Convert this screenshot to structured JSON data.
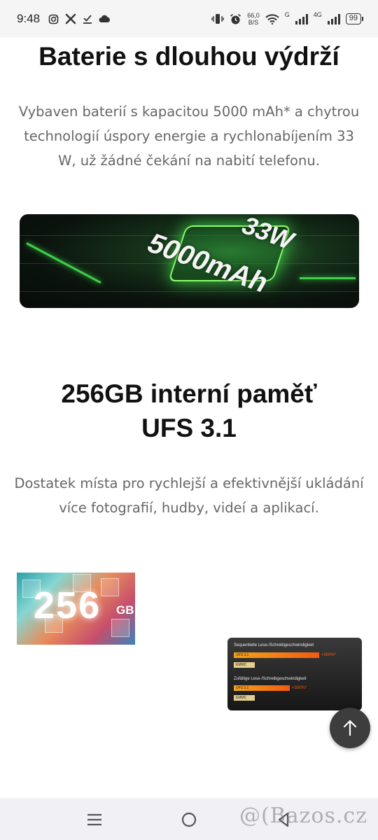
{
  "status_bar": {
    "time": "9:48",
    "net_speed_value": "66,0",
    "net_speed_unit": "B/S",
    "network_1": "G",
    "network_2": "4G",
    "battery_level": "99",
    "left_icons": [
      "instagram-icon",
      "tools-icon",
      "download-check-icon",
      "cloud-icon"
    ],
    "right_icons": [
      "vibrate-icon",
      "alarm-icon",
      "wifi-icon",
      "signal-icon"
    ]
  },
  "battery_section": {
    "heading": "Baterie s dlouhou výdrží",
    "description": "Vybaven baterií s kapacitou 5000 mAh* a chytrou technologií úspory energie a rychlonabíjením 33 W, už žádné čekání na nabití telefonu.",
    "banner_text_power": "33W",
    "banner_text_capacity": "5000mAh",
    "banner_accent": "#3fd04a"
  },
  "storage_section": {
    "heading_line1": "256GB interní paměť",
    "heading_line2": "UFS 3.1",
    "description": "Dostatek místa pro rychlejší a efektivnější ukládání více fotografií, hudby, videí a aplikací.",
    "image_text": "256",
    "image_unit": "GB"
  },
  "speed_card": {
    "sequential_title": "Sequentielle Lese-/Schreibgeschwindigkeit",
    "sequential_ufs_label": "UFS 3.1",
    "sequential_ufs_pct": "+500%*",
    "sequential_emmc_label": "EMMC",
    "random_title": "Zufällige Lese-/Schreibgeschwindigkeit",
    "random_ufs_label": "UFS 3.1",
    "random_ufs_pct": "+300%*",
    "random_emmc_label": "EMMC",
    "accent": "#f25a12"
  },
  "scroll_top_button": {
    "icon": "arrow-up-icon"
  },
  "navigation_bar": {
    "icons": [
      "menu-icon",
      "home-icon",
      "back-icon"
    ],
    "watermark": "@(Bazos.cz"
  }
}
